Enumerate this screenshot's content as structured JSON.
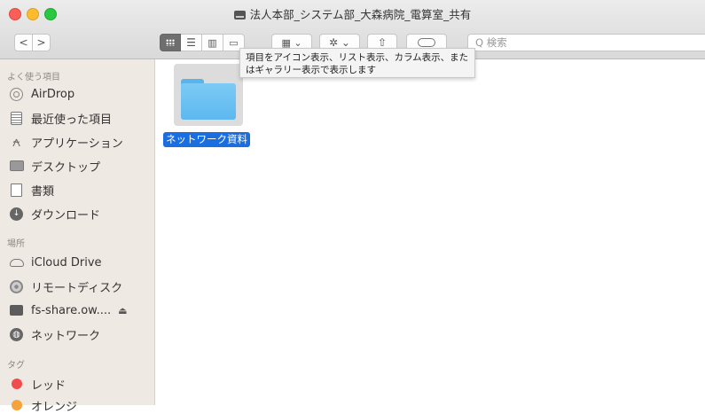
{
  "window": {
    "title": "法人本部_システム部_大森病院_電算室_共有"
  },
  "toolbar": {
    "back_glyph": "<",
    "forward_glyph": ">",
    "view_icons": [
      "icon-view",
      "list-view",
      "column-view",
      "gallery-view"
    ],
    "active_view": "icon-view",
    "search_placeholder": "Q 検索",
    "tooltip": "項目をアイコン表示、リスト表示、カラム表示、またはギャラリー表示で表示します"
  },
  "sidebar": {
    "sections": [
      {
        "header": "よく使う項目",
        "items": [
          {
            "label": "AirDrop",
            "icon": "airdrop-icon"
          },
          {
            "label": "最近使った項目",
            "icon": "recents-icon"
          },
          {
            "label": "アプリケーション",
            "icon": "applications-icon"
          },
          {
            "label": "デスクトップ",
            "icon": "desktop-icon"
          },
          {
            "label": "書類",
            "icon": "documents-icon"
          },
          {
            "label": "ダウンロード",
            "icon": "downloads-icon"
          }
        ]
      },
      {
        "header": "場所",
        "items": [
          {
            "label": "iCloud Drive",
            "icon": "icloud-icon"
          },
          {
            "label": "リモートディスク",
            "icon": "remote-disc-icon"
          },
          {
            "label": "fs-share.ow....",
            "icon": "server-icon"
          },
          {
            "label": "ネットワーク",
            "icon": "network-icon"
          }
        ]
      },
      {
        "header": "タグ",
        "items": [
          {
            "label": "レッド",
            "icon": "red-tag-icon",
            "color": "#f24b4b"
          },
          {
            "label": "オレンジ",
            "icon": "orange-tag-icon",
            "color": "#f5a33b"
          }
        ]
      }
    ]
  },
  "content": {
    "items": [
      {
        "name": "ネットワーク資料",
        "type": "folder",
        "selected": true
      }
    ]
  },
  "colors": {
    "selection": "#1a6ee0",
    "folder": "#5db8ef",
    "sidebar_bg": "#efe9e4"
  }
}
